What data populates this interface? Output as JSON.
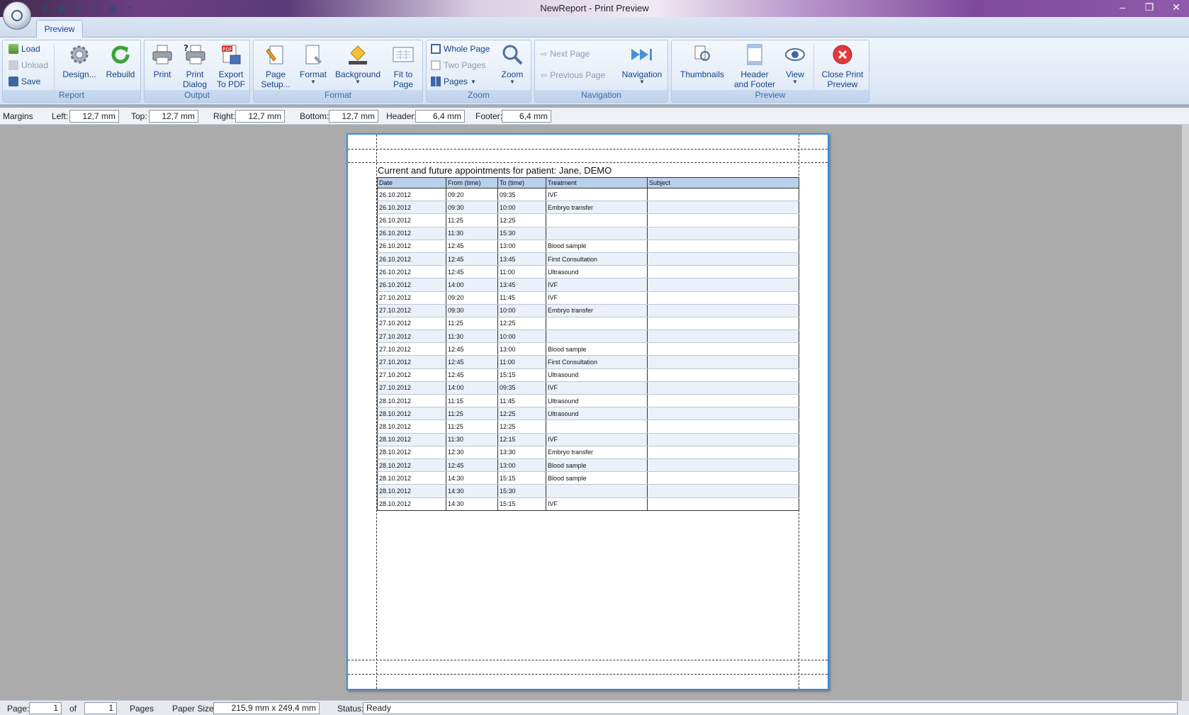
{
  "window": {
    "title": "NewReport - Print Preview"
  },
  "ribbon": {
    "tab": "Preview",
    "groups": {
      "report": {
        "label": "Report",
        "load": "Load",
        "unload": "Unload",
        "save": "Save",
        "design": "Design...",
        "rebuild": "Rebuild"
      },
      "output": {
        "label": "Output",
        "print": "Print",
        "print_dialog_1": "Print",
        "print_dialog_2": "Dialog",
        "export_1": "Export",
        "export_2": "To PDF"
      },
      "format": {
        "label": "Format",
        "page_setup_1": "Page",
        "page_setup_2": "Setup...",
        "format": "Format",
        "background": "Background",
        "fit_1": "Fit to",
        "fit_2": "Page"
      },
      "zoom": {
        "label": "Zoom",
        "whole_page": "Whole Page",
        "two_pages": "Two Pages",
        "pages": "Pages",
        "zoom": "Zoom"
      },
      "navigation": {
        "label": "Navigation",
        "next_page": "Next Page",
        "previous_page": "Previous Page",
        "navigation": "Navigation"
      },
      "preview": {
        "label": "Preview",
        "thumbnails": "Thumbnails",
        "header_footer_1": "Header",
        "header_footer_2": "and Footer",
        "view": "View",
        "close_1": "Close Print",
        "close_2": "Preview"
      }
    }
  },
  "margins": {
    "label": "Margins",
    "left_label": "Left:",
    "left": "12,7 mm",
    "top_label": "Top:",
    "top": "12,7 mm",
    "right_label": "Right:",
    "right": "12,7 mm",
    "bottom_label": "Bottom:",
    "bottom": "12,7 mm",
    "header_label": "Header:",
    "header": "6,4 mm",
    "footer_label": "Footer:",
    "footer": "6,4 mm"
  },
  "report": {
    "title": "Current and future appointments for patient: Jane, DEMO",
    "columns": [
      "Date",
      "From (time)",
      "To (time)",
      "Treatment",
      "Subject"
    ],
    "rows": [
      [
        "26.10.2012",
        "09:20",
        "09:35",
        "IVF",
        ""
      ],
      [
        "26.10.2012",
        "09:30",
        "10:00",
        "Embryo transfer",
        ""
      ],
      [
        "26.10.2012",
        "11:25",
        "12:25",
        "",
        ""
      ],
      [
        "26.10.2012",
        "11:30",
        "15:30",
        "",
        ""
      ],
      [
        "26.10.2012",
        "12:45",
        "13:00",
        "Blood sample",
        ""
      ],
      [
        "26.10.2012",
        "12:45",
        "13:45",
        "First Consultation",
        ""
      ],
      [
        "26.10.2012",
        "12:45",
        "11:00",
        "Ultrasound",
        ""
      ],
      [
        "26.10.2012",
        "14:00",
        "13:45",
        "IVF",
        ""
      ],
      [
        "27.10.2012",
        "09:20",
        "11:45",
        "IVF",
        ""
      ],
      [
        "27.10.2012",
        "09:30",
        "10:00",
        "Embryo transfer",
        ""
      ],
      [
        "27.10.2012",
        "11:25",
        "12:25",
        "",
        ""
      ],
      [
        "27.10.2012",
        "11:30",
        "10:00",
        "",
        ""
      ],
      [
        "27.10.2012",
        "12:45",
        "13:00",
        "Blood sample",
        ""
      ],
      [
        "27.10.2012",
        "12:45",
        "11:00",
        "First Consultation",
        ""
      ],
      [
        "27.10.2012",
        "12:45",
        "15:15",
        "Ultrasound",
        ""
      ],
      [
        "27.10.2012",
        "14:00",
        "09:35",
        "IVF",
        ""
      ],
      [
        "28.10.2012",
        "11:15",
        "11:45",
        "Ultrasound",
        ""
      ],
      [
        "28.10.2012",
        "11:25",
        "12:25",
        "Ultrasound",
        ""
      ],
      [
        "28.10.2012",
        "11:25",
        "12:25",
        "",
        ""
      ],
      [
        "28.10.2012",
        "11:30",
        "12:15",
        "IVF",
        ""
      ],
      [
        "28.10.2012",
        "12:30",
        "13:30",
        "Embryo transfer",
        ""
      ],
      [
        "28.10.2012",
        "12:45",
        "13:00",
        "Blood sample",
        ""
      ],
      [
        "28.10.2012",
        "14:30",
        "15:15",
        "Blood sample",
        ""
      ],
      [
        "28.10.2012",
        "14:30",
        "15:30",
        "",
        ""
      ],
      [
        "28.10.2012",
        "14:30",
        "15:15",
        "IVF",
        ""
      ]
    ]
  },
  "status": {
    "page_label": "Page:",
    "page": "1",
    "of_label": "of",
    "total": "1",
    "pages_label": "Pages",
    "paper_label": "Paper Size:",
    "paper_size": "215,9 mm x 249,4 mm",
    "status_label": "Status:",
    "status": "Ready"
  },
  "colors": {
    "accent": "#15428b",
    "page_border": "#3a8ee6",
    "header_row": "#b8d0ec",
    "close_icon": "#e03a3a"
  }
}
